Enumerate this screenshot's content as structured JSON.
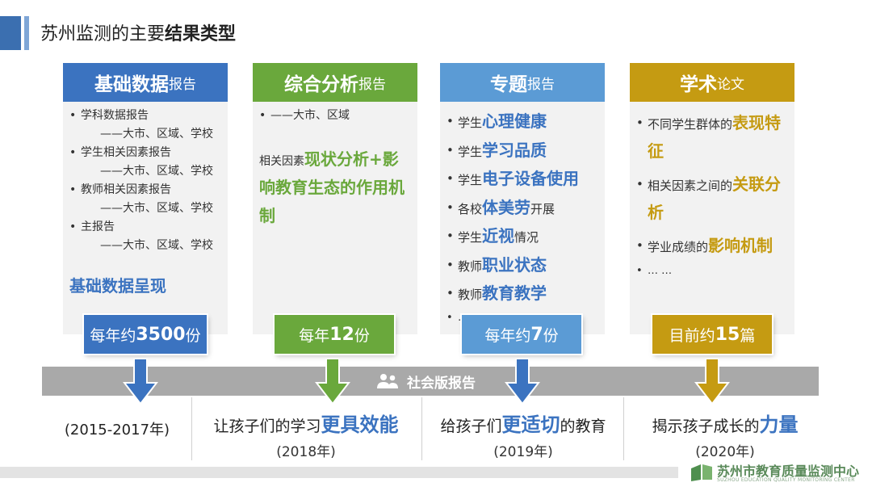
{
  "title": {
    "prefix": "苏州监测的主要",
    "bold": "结果类型"
  },
  "colors": {
    "blue": "#3b73c0",
    "green": "#6aa83c",
    "skyblue": "#5b9bd5",
    "gold": "#c59b12",
    "band": "#a9a9a9"
  },
  "columns": [
    {
      "head_big": "基础数据",
      "head_small": "报告",
      "items": [
        {
          "text": "学科数据报告",
          "sub": "——大市、区域、学校"
        },
        {
          "text": "学生相关因素报告",
          "sub": "——大市、区域、学校"
        },
        {
          "text": "教师相关因素报告",
          "sub": "——大市、区域、学校"
        },
        {
          "text": "主报告",
          "sub": "——大市、区域、学校"
        }
      ],
      "highlight": "基础数据呈现",
      "pill_pre": "每年约",
      "pill_num": "3500",
      "pill_post": "份"
    },
    {
      "head_big": "综合分析",
      "head_small": "报告",
      "item": "——大市、区域",
      "lead": "相关因素",
      "highlight": "现状分析+影响教育生态的作用机制",
      "pill_pre": "每年",
      "pill_num": "12",
      "pill_post": "份"
    },
    {
      "head_big": "专题",
      "head_small": "报告",
      "items": [
        {
          "pre": "学生",
          "hl": "心理健康",
          "post": ""
        },
        {
          "pre": "学生",
          "hl": "学习品质",
          "post": ""
        },
        {
          "pre": "学生",
          "hl": "电子设备使用",
          "post": ""
        },
        {
          "pre": "各校",
          "hl": "体美劳",
          "post": "开展"
        },
        {
          "pre": "学生",
          "hl": "近视",
          "post": "情况"
        },
        {
          "pre": "教师",
          "hl": "职业状态",
          "post": ""
        },
        {
          "pre": "教师",
          "hl": "教育教学",
          "post": ""
        },
        {
          "pre": "… …",
          "hl": "",
          "post": ""
        }
      ],
      "pill_pre": "每年约",
      "pill_num": "7",
      "pill_post": "份"
    },
    {
      "head_big": "学术",
      "head_small": "论文",
      "items": [
        {
          "pre": "不同学生群体的",
          "hl": "表现特征"
        },
        {
          "pre": "相关因素之间的",
          "hl": "关联分析"
        },
        {
          "pre": "学业成绩的",
          "hl": "影响机制"
        },
        {
          "pre": "… …",
          "hl": ""
        }
      ],
      "pill_pre": "目前约",
      "pill_num": "15",
      "pill_post": "篇"
    }
  ],
  "band_label": "社会版报告",
  "captions": [
    {
      "pre": "",
      "em": "",
      "post": "",
      "year": "(2015-2017年)"
    },
    {
      "pre": "让孩子们的学习",
      "em": "更具效能",
      "post": "",
      "year": "(2018年)"
    },
    {
      "pre": "给孩子们",
      "em": "更适切",
      "post": "的教育",
      "year": "(2019年)"
    },
    {
      "pre": "揭示孩子成长的",
      "em": "力量",
      "post": "",
      "year": "(2020年)"
    }
  ],
  "footer": {
    "org": "苏州市教育质量监测中心",
    "sub": "SUZHOU EDUCATION QUALITY MONITORING CENTER"
  }
}
